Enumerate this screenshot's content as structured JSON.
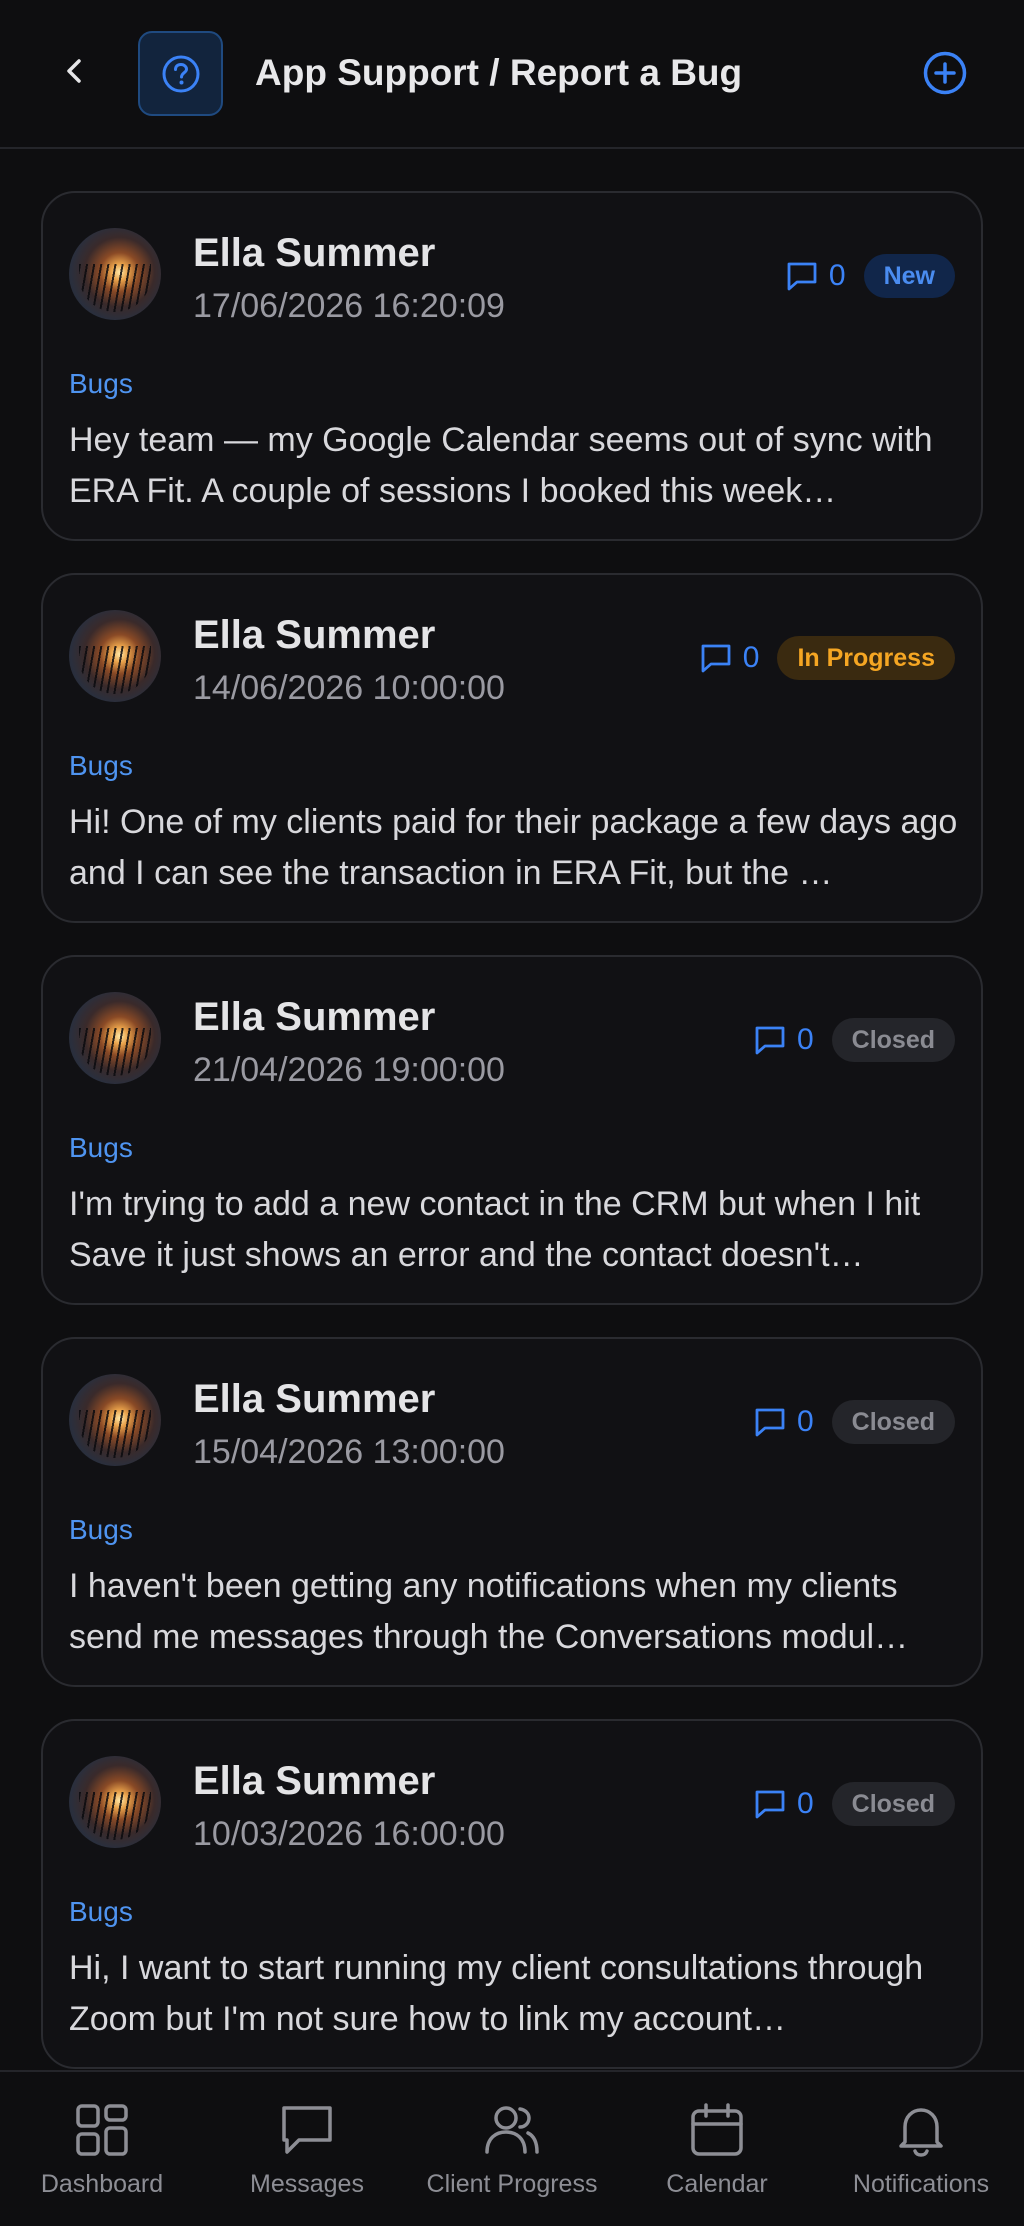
{
  "header": {
    "title": "App Support / Report a Bug",
    "back_icon": "chevron-left-icon",
    "help_icon": "question-circle-icon",
    "add_icon": "plus-circle-icon"
  },
  "colors": {
    "accent": "#3b82f6",
    "new_badge": "#4a8cf0",
    "in_progress_badge": "#f5a623",
    "closed_badge": "#8a8b92"
  },
  "tickets": [
    {
      "name": "Ella Summer",
      "date": "17/06/2026 16:20:09",
      "comments": "0",
      "status": "New",
      "category": "Bugs",
      "description": "Hey team — my Google Calendar seems out of sync with ERA Fit. A couple of sessions I booked this week…"
    },
    {
      "name": "Ella Summer",
      "date": "14/06/2026 10:00:00",
      "comments": "0",
      "status": "In Progress",
      "category": "Bugs",
      "description": "Hi! One of my clients paid for their package a few days ago and I can see the transaction in ERA Fit, but the …"
    },
    {
      "name": "Ella Summer",
      "date": "21/04/2026 19:00:00",
      "comments": "0",
      "status": "Closed",
      "category": "Bugs",
      "description": "I'm trying to add a new contact in the CRM but when I hit Save it just shows an error and the contact doesn't…"
    },
    {
      "name": "Ella Summer",
      "date": "15/04/2026 13:00:00",
      "comments": "0",
      "status": "Closed",
      "category": "Bugs",
      "description": "I haven't been getting any notifications when my clients send me messages through the Conversations modul…"
    },
    {
      "name": "Ella Summer",
      "date": "10/03/2026 16:00:00",
      "comments": "0",
      "status": "Closed",
      "category": "Bugs",
      "description": "Hi, I want to start running my client consultations through Zoom but I'm not sure how to link my account…"
    }
  ],
  "tabbar": {
    "items": [
      {
        "label": "Dashboard",
        "icon": "grid-icon"
      },
      {
        "label": "Messages",
        "icon": "message-icon"
      },
      {
        "label": "Client Progress",
        "icon": "users-icon"
      },
      {
        "label": "Calendar",
        "icon": "calendar-icon"
      },
      {
        "label": "Notifications",
        "icon": "bell-icon"
      }
    ]
  }
}
